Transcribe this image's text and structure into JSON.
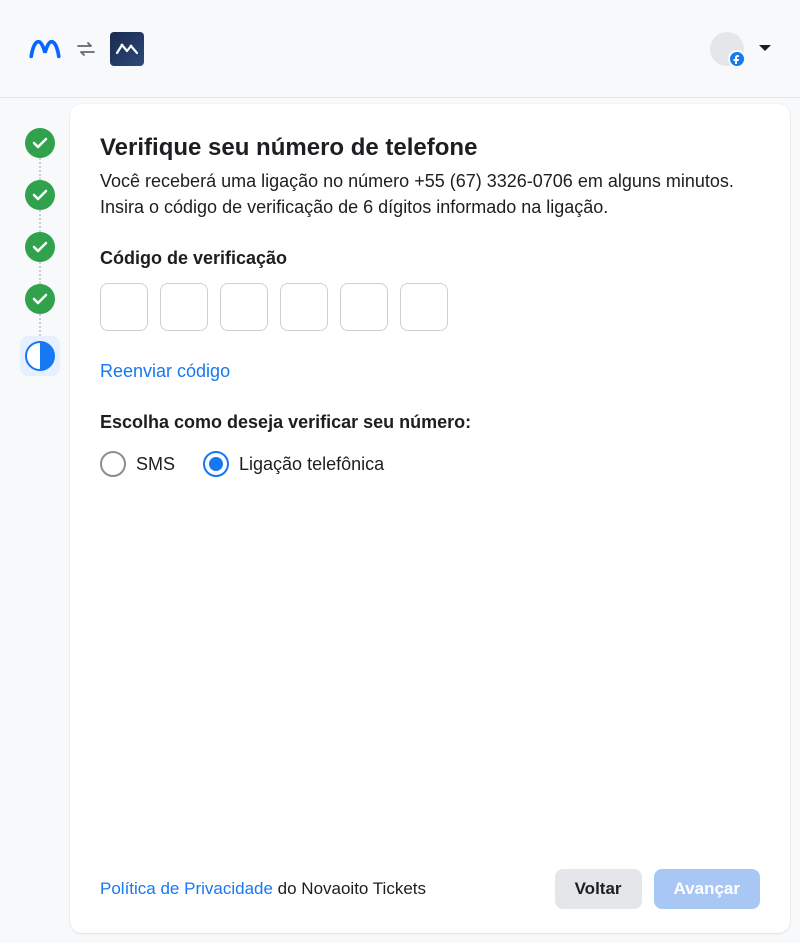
{
  "header": {
    "app_icon_name": "app-tile-icon"
  },
  "stepper": {
    "completed_steps": 4,
    "current_step": 5
  },
  "main": {
    "title": "Verifique seu número de telefone",
    "subtitle": "Você receberá uma ligação no número +55 (67) 3326-0706 em alguns minutos. Insira o código de verificação de 6 dígitos informado na ligação.",
    "code_label": "Código de verificação",
    "code_length": 6,
    "resend_label": "Reenviar código",
    "choice_label": "Escolha como deseja verificar seu número:",
    "options": {
      "sms": "SMS",
      "call": "Ligação telefônica",
      "selected": "call"
    }
  },
  "footer": {
    "privacy_link": "Política de Privacidade",
    "privacy_suffix": " do Novaoito Tickets",
    "back_label": "Voltar",
    "next_label": "Avançar"
  }
}
